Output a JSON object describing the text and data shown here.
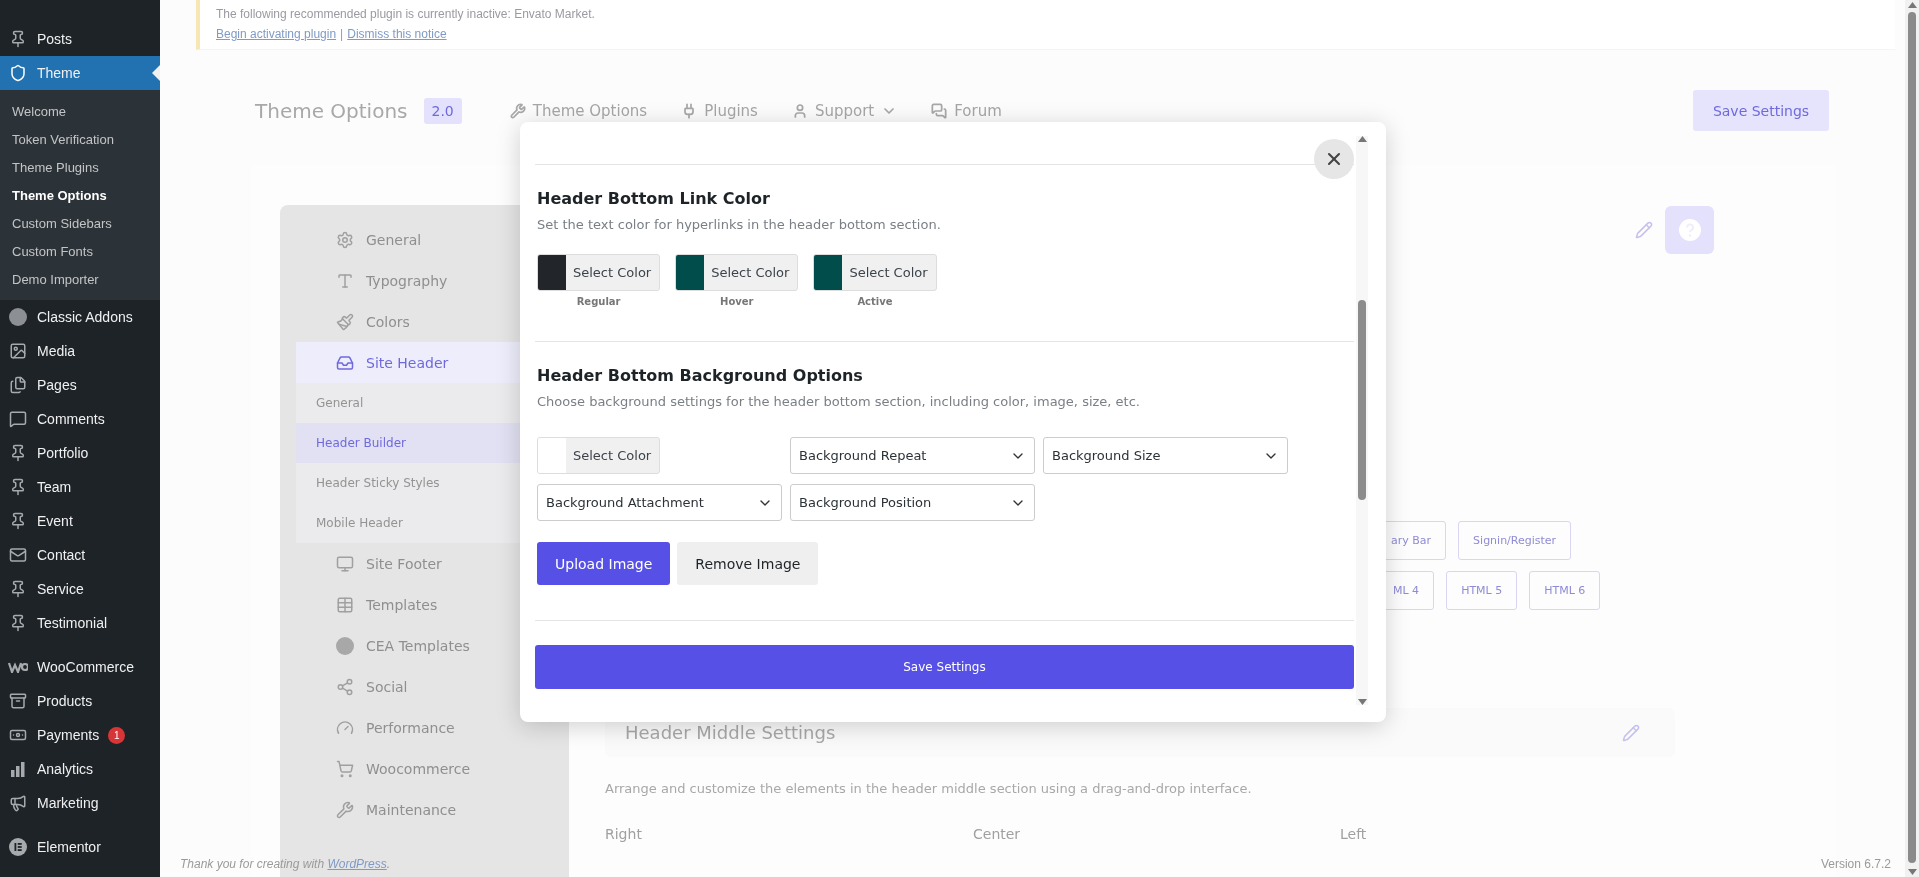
{
  "admin_menu": {
    "groups": [
      {
        "items": [
          {
            "label": "Posts",
            "selected": false
          },
          {
            "label": "Theme",
            "selected": true,
            "children": [
              {
                "label": "Welcome",
                "selected": false
              },
              {
                "label": "Token Verification",
                "selected": false
              },
              {
                "label": "Theme Plugins",
                "selected": false
              },
              {
                "label": "Theme Options",
                "selected": true
              },
              {
                "label": "Custom Sidebars",
                "selected": false
              },
              {
                "label": "Custom Fonts",
                "selected": false
              },
              {
                "label": "Demo Importer",
                "selected": false
              }
            ]
          },
          {
            "label": "Classic Addons",
            "selected": false
          },
          {
            "label": "Media",
            "selected": false
          },
          {
            "label": "Pages",
            "selected": false
          },
          {
            "label": "Comments",
            "selected": false
          },
          {
            "label": "Portfolio",
            "selected": false
          },
          {
            "label": "Team",
            "selected": false
          },
          {
            "label": "Event",
            "selected": false
          },
          {
            "label": "Contact",
            "selected": false
          },
          {
            "label": "Service",
            "selected": false
          },
          {
            "label": "Testimonial",
            "selected": false
          }
        ]
      },
      {
        "items": [
          {
            "label": "WooCommerce",
            "selected": false
          },
          {
            "label": "Products",
            "selected": false
          },
          {
            "label": "Payments",
            "selected": false,
            "badge": "1"
          },
          {
            "label": "Analytics",
            "selected": false
          },
          {
            "label": "Marketing",
            "selected": false
          }
        ]
      },
      {
        "items": [
          {
            "label": "Elementor",
            "selected": false
          }
        ]
      }
    ]
  },
  "notice": {
    "text": "The following recommended plugin is currently inactive: Envato Market.",
    "links": [
      "Begin activating plugin",
      "Dismiss this notice"
    ],
    "separator": "|"
  },
  "header": {
    "title": "Theme Options",
    "version": "2.0",
    "nav": [
      {
        "label": "Theme Options",
        "dropdown": false
      },
      {
        "label": "Plugins",
        "dropdown": false
      },
      {
        "label": "Support",
        "dropdown": true
      },
      {
        "label": "Forum",
        "dropdown": false
      }
    ],
    "save_button": "Save Settings"
  },
  "options_nav": [
    {
      "label": "General",
      "selected": false
    },
    {
      "label": "Typography",
      "selected": false
    },
    {
      "label": "Colors",
      "selected": false
    },
    {
      "label": "Site Header",
      "selected": true,
      "children": [
        {
          "label": "General",
          "selected": false
        },
        {
          "label": "Header Builder",
          "selected": true
        },
        {
          "label": "Header Sticky Styles",
          "selected": false
        },
        {
          "label": "Mobile Header",
          "selected": false
        }
      ]
    },
    {
      "label": "Site Footer",
      "selected": false
    },
    {
      "label": "Templates",
      "selected": false
    },
    {
      "label": "CEA Templates",
      "selected": false
    },
    {
      "label": "Social",
      "selected": false
    },
    {
      "label": "Performance",
      "selected": false
    },
    {
      "label": "Woocommerce",
      "selected": false
    },
    {
      "label": "Maintenance",
      "selected": false
    }
  ],
  "content": {
    "chips_row_1": [
      "ary Bar",
      "Signin/Register"
    ],
    "chips_row_2": [
      "ML 4",
      "HTML 5",
      "HTML 6"
    ],
    "middle_section": {
      "title": "Header Middle Settings",
      "description": "Arrange and customize the elements in the header middle section using a drag-and-drop interface.",
      "columns": [
        "Right",
        "Center",
        "Left"
      ]
    }
  },
  "footer": {
    "text": "Thank you for creating with ",
    "link": "WordPress",
    "end": ".",
    "version": "Version 6.7.2"
  },
  "modal": {
    "sections": [
      {
        "title": "Header Bottom Link Color",
        "description": "Set the text color for hyperlinks in the header bottom section.",
        "pickers": [
          {
            "button": "Select Color",
            "label": "Regular",
            "color": "#222529"
          },
          {
            "button": "Select Color",
            "label": "Hover",
            "color": "#004d4b"
          },
          {
            "button": "Select Color",
            "label": "Active",
            "color": "#004d4b"
          }
        ]
      },
      {
        "title": "Header Bottom Background Options",
        "description": "Choose background settings for the header bottom section, including color, image, size, etc.",
        "fields": [
          {
            "kind": "picker",
            "button": "Select Color",
            "color": "#ffffff"
          },
          {
            "kind": "select",
            "value": "Background Repeat"
          },
          {
            "kind": "select",
            "value": "Background Size"
          },
          {
            "kind": "select",
            "value": "Background Attachment"
          },
          {
            "kind": "select",
            "value": "Background Position"
          }
        ],
        "buttons": [
          {
            "label": "Upload Image",
            "kind": "primary"
          },
          {
            "label": "Remove Image",
            "kind": "secondary"
          }
        ]
      }
    ],
    "save_button": "Save Settings"
  }
}
